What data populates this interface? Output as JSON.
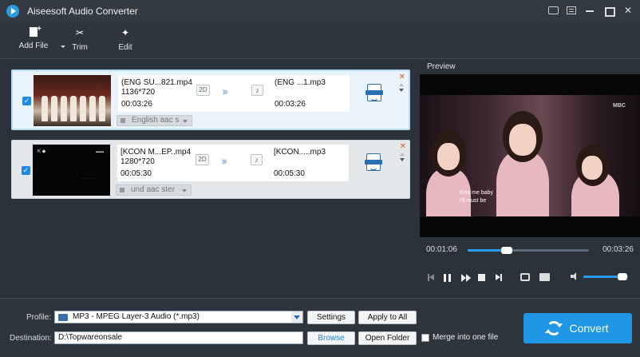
{
  "window": {
    "title": "Aiseesoft Audio Converter"
  },
  "toolbar": {
    "add_file": "Add File",
    "trim": "Trim",
    "edit": "Edit"
  },
  "files": [
    {
      "src_name": "(ENG SU...821.mp4",
      "src_res": "1136*720",
      "src_dur": "00:03:26",
      "badge_2d": "2D",
      "out_name": "(ENG ...1.mp3",
      "out_dur": "00:03:26",
      "audio_track": "English aac s",
      "checked": true
    },
    {
      "src_name": "[KCON M...EP..mp4",
      "src_res": "1280*720",
      "src_dur": "00:05:30",
      "badge_2d": "2D",
      "out_name": "[KCON.....mp3",
      "out_dur": "00:05:30",
      "audio_track": "und aac ster",
      "checked": true
    }
  ],
  "preview": {
    "label": "Preview",
    "brand": "MBC",
    "subtitle_line1": "Kiss me baby",
    "subtitle_line2": "I'll must be",
    "time_current": "00:01:06",
    "time_total": "00:03:26",
    "progress": 0.32,
    "volume": 0.88
  },
  "bottom": {
    "profile_label": "Profile:",
    "profile_value": "MP3 - MPEG Layer-3 Audio (*.mp3)",
    "settings": "Settings",
    "apply_all": "Apply to All",
    "dest_label": "Destination:",
    "dest_value": "D:\\Topwareonsale",
    "browse": "Browse",
    "open_folder": "Open Folder",
    "merge": "Merge into one file",
    "convert": "Convert"
  },
  "colors": {
    "accent": "#1f97e4",
    "delete": "#e05a2a"
  }
}
